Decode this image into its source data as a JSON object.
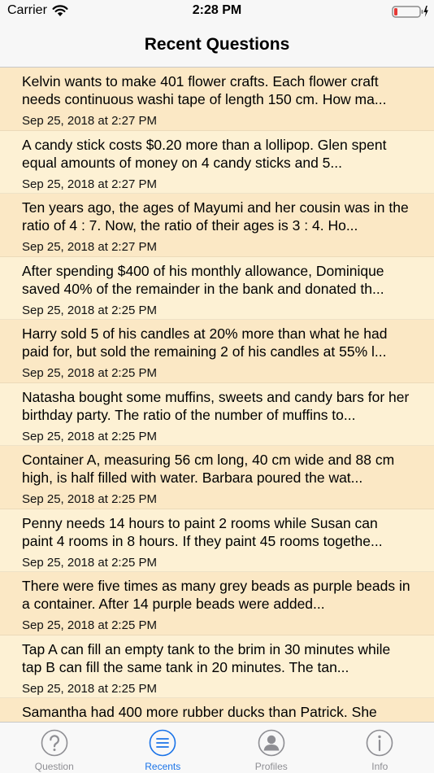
{
  "status_bar": {
    "carrier": "Carrier",
    "time": "2:28 PM",
    "battery": "low"
  },
  "nav": {
    "title": "Recent Questions"
  },
  "questions": [
    {
      "text": "Kelvin wants to make 401 flower crafts. Each flower craft needs continuous washi tape of length 150 cm. How ma...",
      "date": "Sep 25, 2018 at 2:27 PM"
    },
    {
      "text": "A candy stick costs $0.20 more than a lollipop. Glen spent equal amounts of money on 4 candy sticks and  5...",
      "date": "Sep 25, 2018 at 2:27 PM"
    },
    {
      "text": "Ten years ago, the ages of Mayumi and her cousin was in the ratio of 4 : 7. Now, the ratio of their ages is 3 : 4. Ho...",
      "date": "Sep 25, 2018 at 2:27 PM"
    },
    {
      "text": "After spending $400 of his monthly allowance, Dominique saved 40% of the remainder in the bank and donated th...",
      "date": "Sep 25, 2018 at 2:25 PM"
    },
    {
      "text": "Harry sold 5 of his candles at 20% more than what he had paid for, but sold the remaining 2 of his candles at 55% l...",
      "date": "Sep 25, 2018 at 2:25 PM"
    },
    {
      "text": "Natasha bought some muffins, sweets and candy bars for her birthday party. The ratio of the number of muffins to...",
      "date": "Sep 25, 2018 at 2:25 PM"
    },
    {
      "text": "Container A, measuring 56 cm long, 40 cm wide and 88 cm high, is half filled with water. Barbara poured the wat...",
      "date": "Sep 25, 2018 at 2:25 PM"
    },
    {
      "text": "Penny needs 14 hours to paint 2 rooms while Susan can paint 4 rooms in 8 hours. If they paint 45 rooms togethe...",
      "date": "Sep 25, 2018 at 2:25 PM"
    },
    {
      "text": "There were five times as many grey beads as purple beads in a container. After 14 purple beads were added...",
      "date": "Sep 25, 2018 at 2:25 PM"
    },
    {
      "text": "Tap A can fill an empty tank to the brim in 30 minutes while tap B can fill the same tank in 20 minutes. The tan...",
      "date": "Sep 25, 2018 at 2:25 PM"
    },
    {
      "text": "Samantha had 400 more rubber ducks than Patrick. She",
      "date": ""
    }
  ],
  "tabs": [
    {
      "label": "Question",
      "icon": "question-circle-icon",
      "active": false
    },
    {
      "label": "Recents",
      "icon": "list-circle-icon",
      "active": true
    },
    {
      "label": "Profiles",
      "icon": "person-circle-icon",
      "active": false
    },
    {
      "label": "Info",
      "icon": "info-circle-icon",
      "active": false
    }
  ],
  "colors": {
    "row_odd": "#fbe8c5",
    "row_even": "#fdf1d4",
    "tab_active": "#1a73e8",
    "tab_inactive": "#8e8e93",
    "battery_low": "#e53935"
  }
}
